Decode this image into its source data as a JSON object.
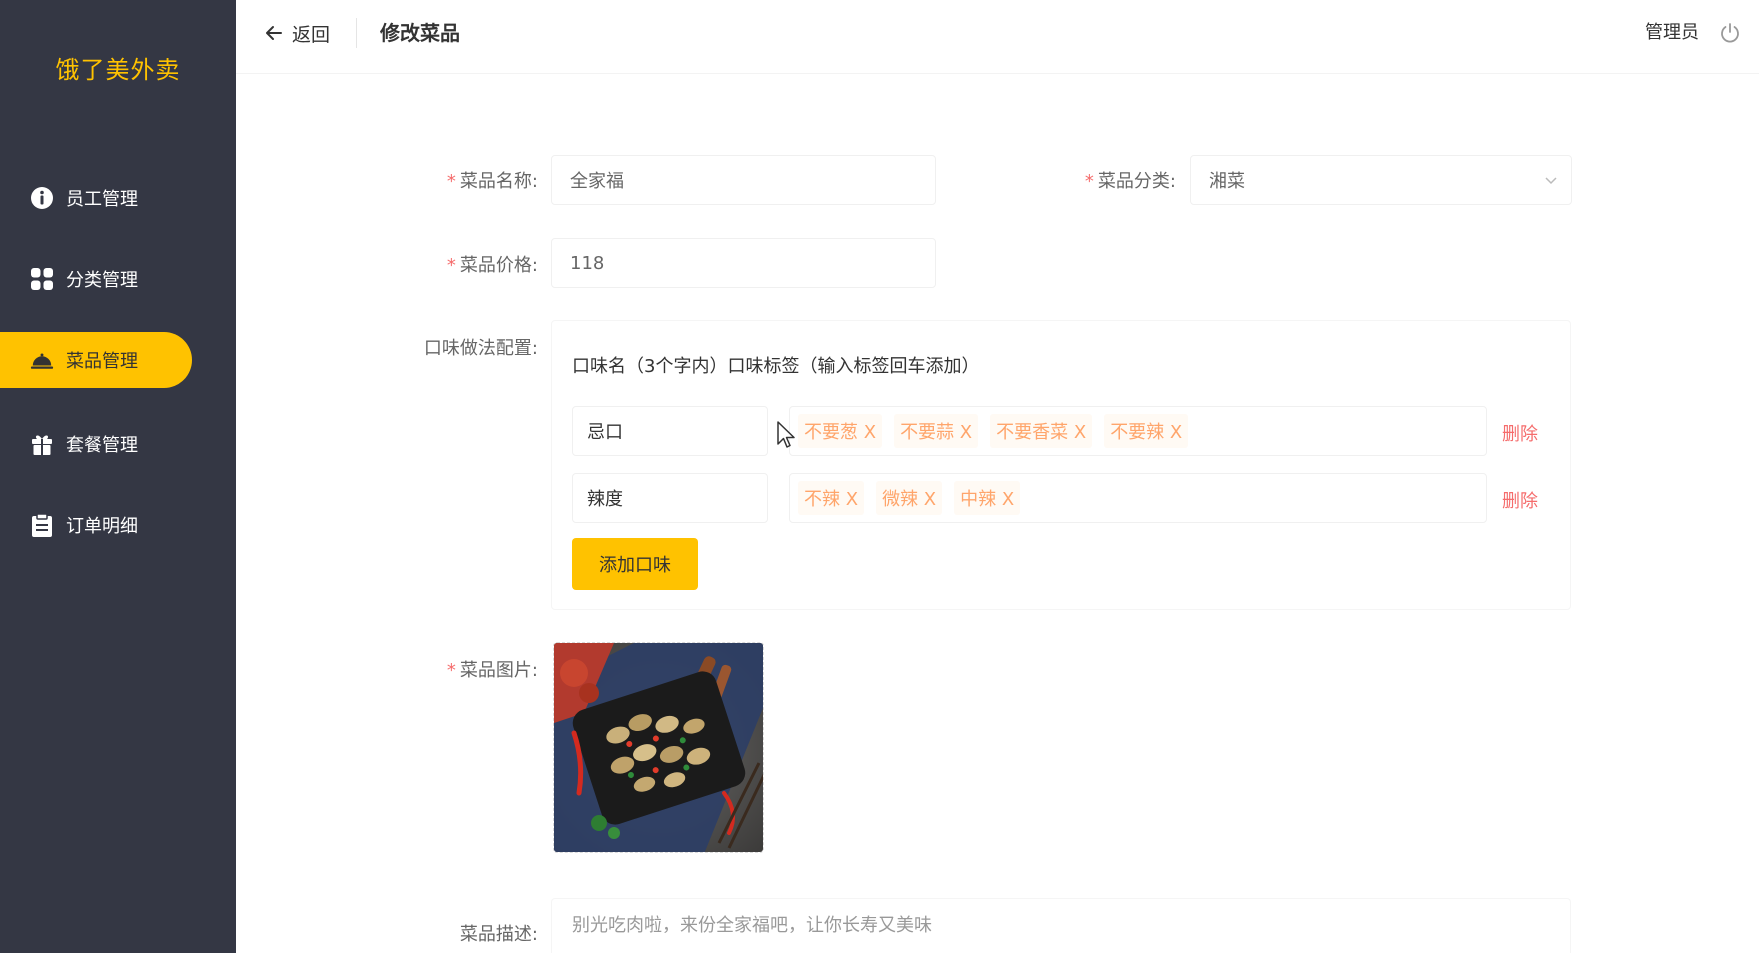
{
  "sidebar": {
    "logo": "饿了美外卖",
    "items": [
      {
        "label": "员工管理",
        "icon": "info-circle-icon",
        "active": false
      },
      {
        "label": "分类管理",
        "icon": "grid-icon",
        "active": false
      },
      {
        "label": "菜品管理",
        "icon": "cloche-icon",
        "active": true
      },
      {
        "label": "套餐管理",
        "icon": "gift-icon",
        "active": false
      },
      {
        "label": "订单明细",
        "icon": "clipboard-icon",
        "active": false
      }
    ]
  },
  "header": {
    "back_label": "返回",
    "title": "修改菜品",
    "user": "管理员"
  },
  "form": {
    "name_label": "菜品名称:",
    "name_value": "全家福",
    "category_label": "菜品分类:",
    "category_value": "湘菜",
    "price_label": "菜品价格:",
    "price_value": "118",
    "flavor_label": "口味做法配置:",
    "flavor_header": "口味名（3个字内）口味标签（输入标签回车添加）",
    "flavors": [
      {
        "name": "忌口",
        "tags": [
          "不要葱 X",
          "不要蒜 X",
          "不要香菜 X",
          "不要辣 X"
        ],
        "delete": "删除"
      },
      {
        "name": "辣度",
        "tags": [
          "不辣 X",
          "微辣 X",
          "中辣 X"
        ],
        "delete": "删除"
      }
    ],
    "add_flavor": "添加口味",
    "image_label": "菜品图片:",
    "desc_label": "菜品描述:",
    "desc_value": "别光吃肉啦，来份全家福吧，让你长寿又美味"
  },
  "colors": {
    "sidebar_bg": "#343744",
    "accent": "#ffc200",
    "tag_text": "#ffa56b",
    "danger": "#f56c6c"
  }
}
